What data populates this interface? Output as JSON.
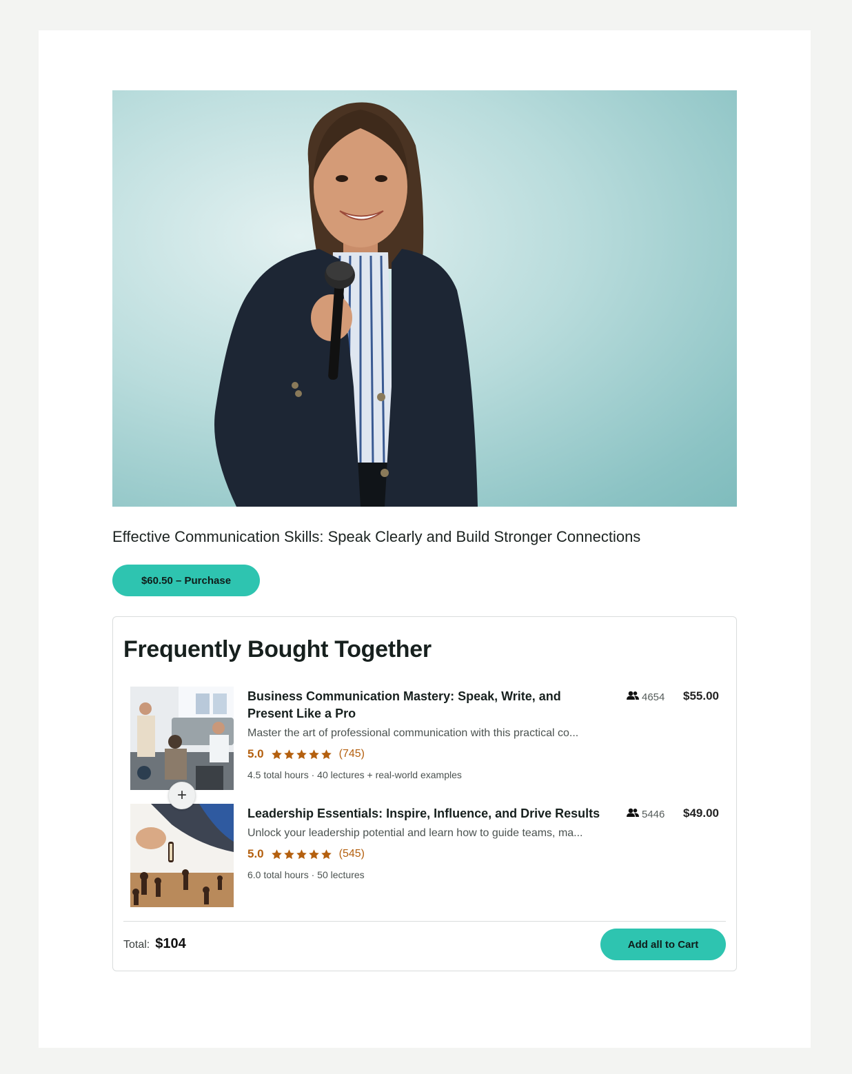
{
  "course": {
    "title": "Effective Communication Skills: Speak Clearly and Build Stronger Connections",
    "purchase_label": "$60.50 – Purchase",
    "hero_image": "woman-speaker-with-microphone"
  },
  "fbt": {
    "title": "Frequently Bought Together",
    "items": [
      {
        "title": "Business Communication Mastery: Speak, Write, and Present Like a Pro",
        "description": "Master the art of professional communication with this practical co...",
        "rating": "5.0",
        "stars": 5,
        "rating_count": "(745)",
        "meta": "4.5 total hours · 40 lectures + real-world examples",
        "students": "4654",
        "price": "$55.00",
        "thumbnail": "office-meeting-photo"
      },
      {
        "title": "Leadership Essentials: Inspire, Influence, and Drive Results",
        "description": "Unlock your leadership potential and learn how to guide teams, ma...",
        "rating": "5.0",
        "stars": 5,
        "rating_count": "(545)",
        "meta": "6.0 total hours · 50 lectures",
        "students": "5446",
        "price": "$49.00",
        "thumbnail": "chess-pieces-photo"
      }
    ],
    "plus_symbol": "+",
    "total_label": "Total:",
    "total_value": "$104",
    "cart_label": "Add all to Cart"
  },
  "colors": {
    "accent": "#2ec4b0",
    "rating": "#b4600f"
  }
}
